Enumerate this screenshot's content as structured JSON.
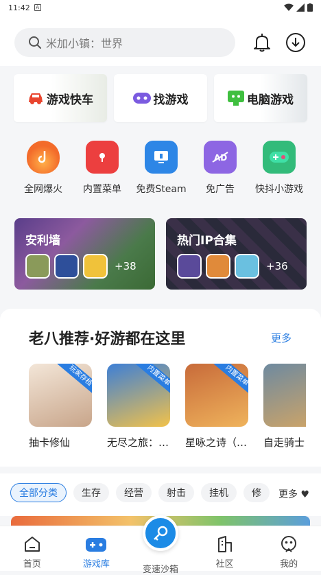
{
  "status": {
    "time": "11:42"
  },
  "search": {
    "placeholder": "米加小镇：世界"
  },
  "feature_cards": [
    {
      "label": "游戏快车",
      "accent": "#e9452f"
    },
    {
      "label": "找游戏",
      "accent": "#7b5be0"
    },
    {
      "label": "电脑游戏",
      "accent": "#3fbf3f"
    }
  ],
  "quick_icons": [
    {
      "label": "全网爆火",
      "icon": "flame-icon",
      "color": "#f36b2a"
    },
    {
      "label": "内置菜单",
      "icon": "menu-icon",
      "color": "#ec3f3f"
    },
    {
      "label": "免费Steam",
      "icon": "monitor-icon",
      "color": "#2d86e6"
    },
    {
      "label": "免广告",
      "icon": "ad-block-icon",
      "color": "#8d66e3"
    },
    {
      "label": "快抖小游戏",
      "icon": "gamepad-icon",
      "color": "#32bb7a"
    }
  ],
  "banners": [
    {
      "title": "安利墙",
      "count": "+38"
    },
    {
      "title": "热门IP合集",
      "count": "+36"
    }
  ],
  "recommend": {
    "title": "老八推荐·好游都在这里",
    "more": "更多",
    "games": [
      {
        "name": "抽卡修仙",
        "ribbon": "玩家存档",
        "c1": "#f3e6d8",
        "c2": "#c8a58a"
      },
      {
        "name": "无尽之旅：…",
        "ribbon": "内置菜单",
        "c1": "#3d7fd6",
        "c2": "#f2c24a"
      },
      {
        "name": "星咏之诗（…",
        "ribbon": "内置菜单",
        "c1": "#c86b3a",
        "c2": "#efb35c"
      },
      {
        "name": "自走骑士",
        "ribbon": "",
        "c1": "#6e8aa0",
        "c2": "#c9a36a"
      }
    ]
  },
  "filters": {
    "chips": [
      "全部分类",
      "生存",
      "经营",
      "射击",
      "挂机",
      "修"
    ],
    "more": "更多 ♥"
  },
  "tabs": [
    {
      "label": "首页",
      "icon": "home-icon"
    },
    {
      "label": "游戏库",
      "icon": "game-library-icon"
    },
    {
      "label": "变速沙箱",
      "icon": "key-icon"
    },
    {
      "label": "社区",
      "icon": "community-icon"
    },
    {
      "label": "我的",
      "icon": "profile-icon"
    }
  ],
  "colors": {
    "brand_blue": "#2a7de1"
  }
}
